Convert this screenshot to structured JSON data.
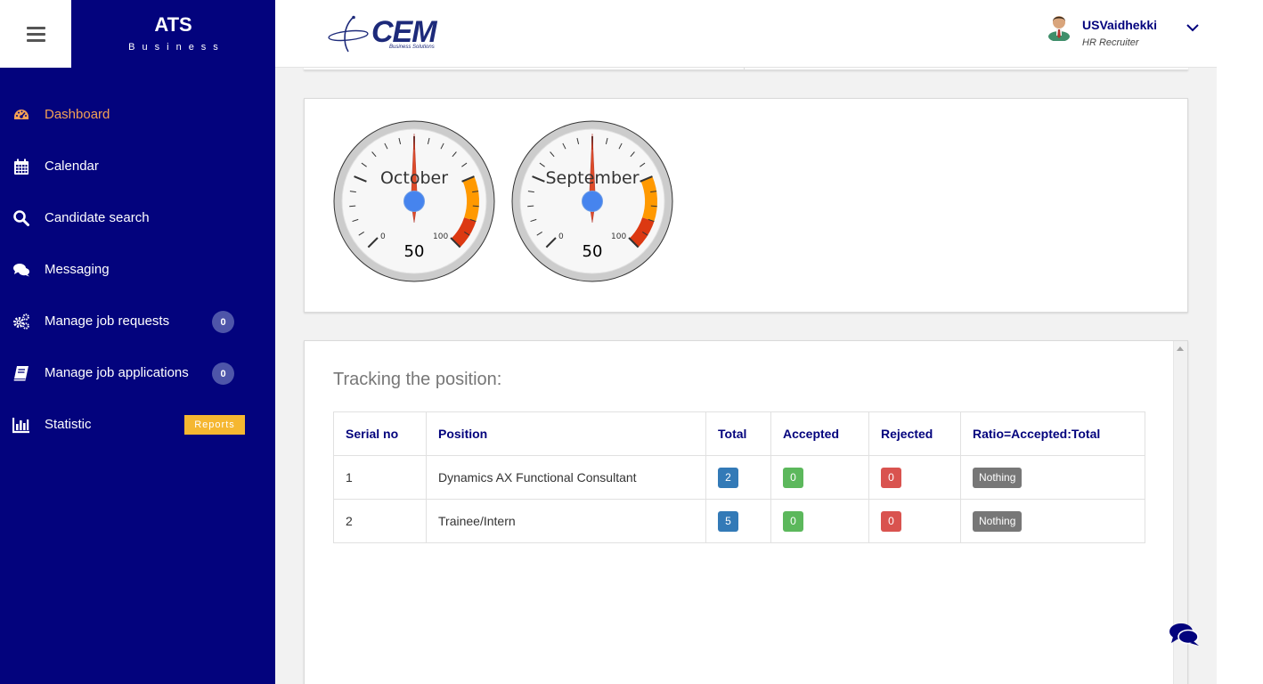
{
  "brand": {
    "title": "ATS",
    "subtitle": "Business"
  },
  "header": {
    "logo_text": "CEM",
    "logo_sub": "Business Solutions",
    "user_name": "USVaidhekki",
    "user_role": "HR Recruiter"
  },
  "sidebar": {
    "items": [
      {
        "label": "Dashboard",
        "icon": "dashboard-icon"
      },
      {
        "label": "Calendar",
        "icon": "calendar-icon"
      },
      {
        "label": "Candidate search",
        "icon": "search-icon"
      },
      {
        "label": "Messaging",
        "icon": "comments-icon"
      },
      {
        "label": "Manage job requests",
        "icon": "cogs-icon",
        "badge": "0"
      },
      {
        "label": "Manage job applications",
        "icon": "book-icon",
        "badge": "0"
      },
      {
        "label": "Statistic",
        "icon": "bar-chart-icon",
        "tag": "Reports"
      }
    ]
  },
  "gauges": [
    {
      "title": "October",
      "value": 50,
      "min": "0",
      "max": "100"
    },
    {
      "title": "September",
      "value": 50,
      "min": "0",
      "max": "100"
    }
  ],
  "tracking": {
    "title": "Tracking the position:",
    "columns": [
      "Serial no",
      "Position",
      "Total",
      "Accepted",
      "Rejected",
      "Ratio=Accepted:Total"
    ],
    "rows": [
      {
        "serial": "1",
        "position": "Dynamics AX Functional Consultant",
        "total": "2",
        "accepted": "0",
        "rejected": "0",
        "ratio": "Nothing"
      },
      {
        "serial": "2",
        "position": "Trainee/Intern",
        "total": "5",
        "accepted": "0",
        "rejected": "0",
        "ratio": "Nothing"
      }
    ]
  },
  "colors": {
    "sidebar_bg": "#03037d",
    "active": "#f3a155",
    "badge": "#4e55a9",
    "reports_tag": "#f5b731",
    "gauge_orange": "#ff9900",
    "gauge_red": "#dc3912",
    "gauge_hub": "#4684ee"
  }
}
